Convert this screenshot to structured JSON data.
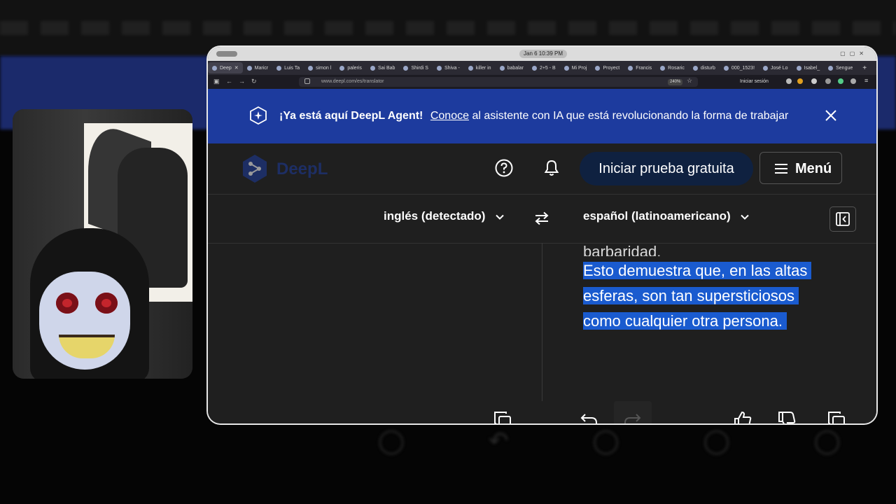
{
  "browser": {
    "os_date": "Jan 6  10:39 PM",
    "tabs": [
      {
        "label": "Deep",
        "active": true
      },
      {
        "label": "Maricr"
      },
      {
        "label": "Luis Ta"
      },
      {
        "label": "simon l"
      },
      {
        "label": "paleris"
      },
      {
        "label": "Sai Bab"
      },
      {
        "label": "Shirdi S"
      },
      {
        "label": "Shiva -"
      },
      {
        "label": "killer in"
      },
      {
        "label": "babalar"
      },
      {
        "label": "2+5 - B"
      },
      {
        "label": "Mi Proj"
      },
      {
        "label": "Proyect"
      },
      {
        "label": "Francis"
      },
      {
        "label": "Rosaric"
      },
      {
        "label": "disturb"
      },
      {
        "label": "000_1523!"
      },
      {
        "label": "José Lo"
      },
      {
        "label": "Isabel_"
      },
      {
        "label": "Sengue"
      }
    ],
    "url": "www.deepl.com/es/translator",
    "zoom": "240%",
    "signin_label": "Iniciar sesión"
  },
  "banner": {
    "headline": "¡Ya está aquí DeepL Agent!",
    "link": "Conoce",
    "text": "al asistente con IA que está revolucionando la forma de trabajar"
  },
  "header": {
    "logo": "DeepL",
    "trial_button": "Iniciar prueba gratuita",
    "menu_button": "Menú"
  },
  "languages": {
    "source": "inglés (detectado)",
    "target": "español (latinoamericano)"
  },
  "output": {
    "partial_line": "barbaridad.",
    "lines": [
      "Esto demuestra que, en las altas",
      "esferas, son tan supersticiosos",
      "como cualquier otra persona."
    ]
  },
  "colors": {
    "banner": "#1d3b9e",
    "highlight": "#1a5bcf",
    "background": "#1f1f1f"
  }
}
